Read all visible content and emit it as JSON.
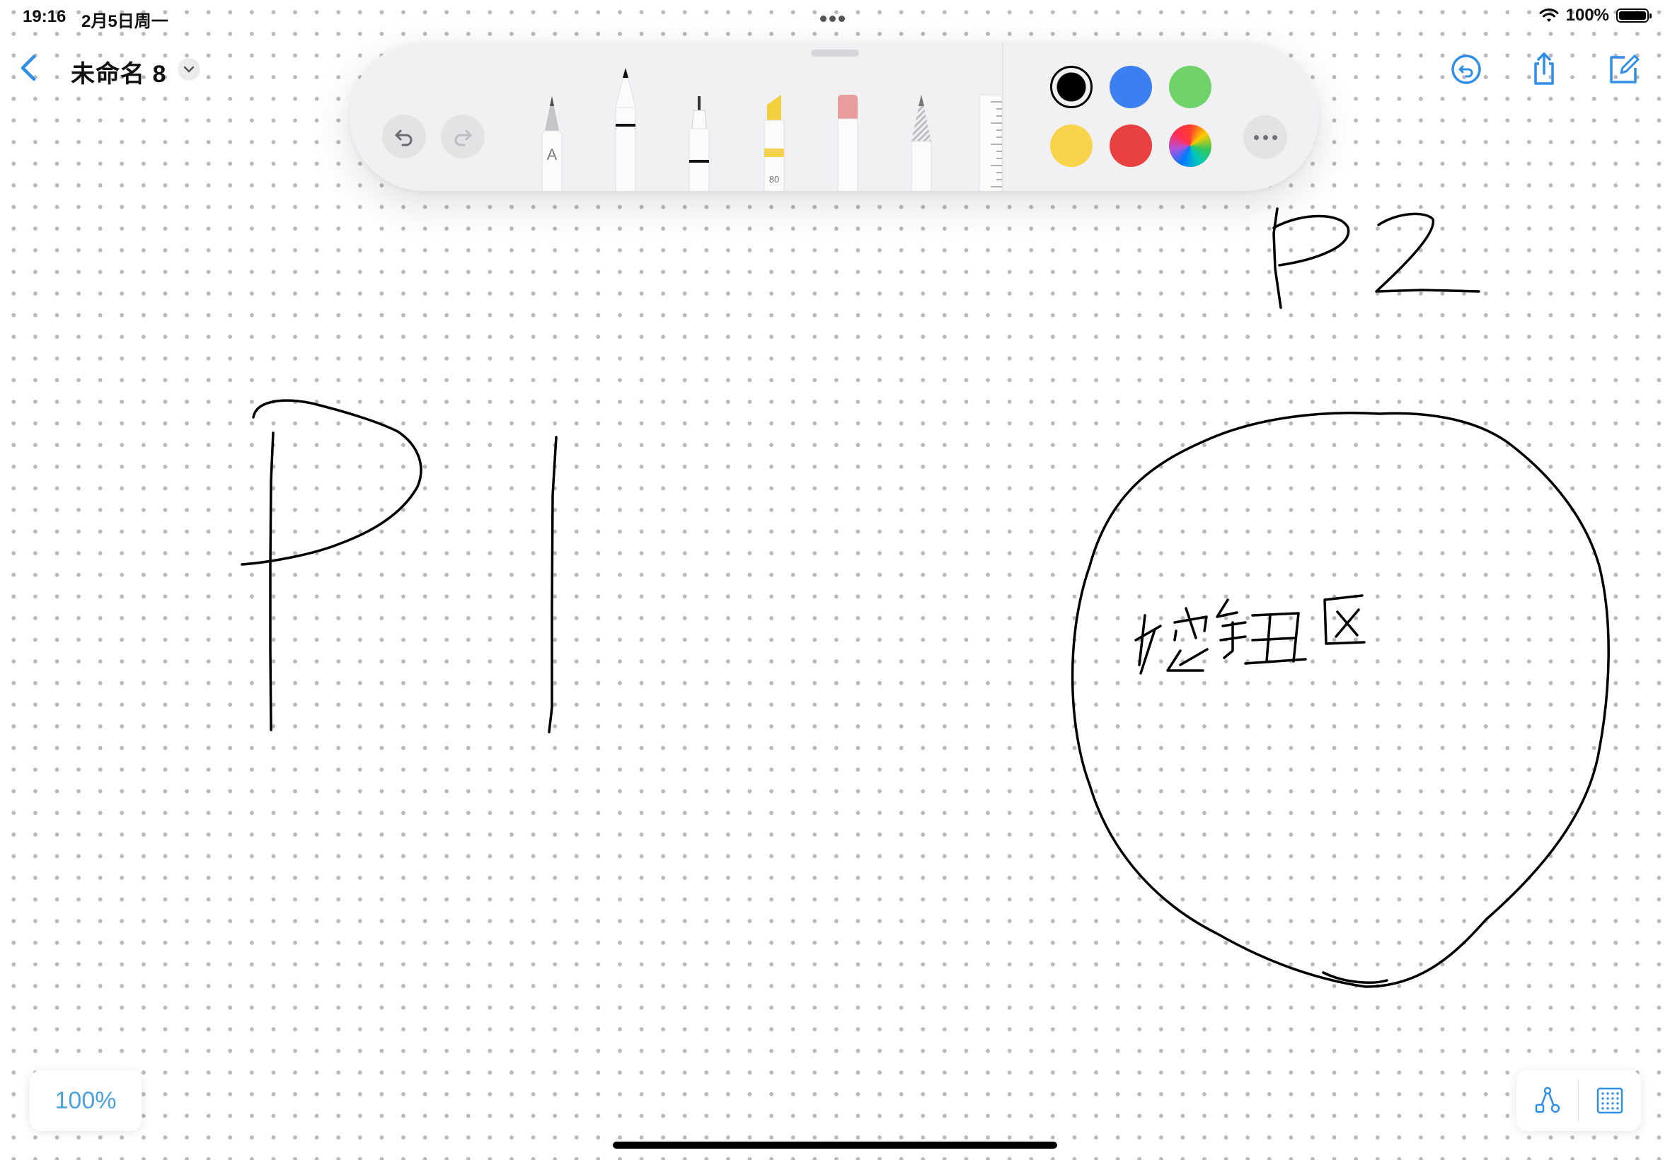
{
  "status_bar": {
    "time": "19:16",
    "date": "2月5日周一",
    "battery_percent": "100%",
    "battery_level": 1.0
  },
  "header": {
    "title": "未命名 8",
    "back_icon": "chevron-left-icon",
    "title_menu_icon": "chevron-down-icon",
    "right_icons": [
      "undo-history-icon",
      "share-icon",
      "compose-icon"
    ]
  },
  "toolbar": {
    "undo_icon": "undo-icon",
    "redo_icon": "redo-icon",
    "tools": [
      "monoline-pen",
      "pen",
      "fineliner",
      "marker",
      "eraser",
      "pencil",
      "ruler"
    ],
    "monoline_label": "A",
    "marker_opacity_label": "80",
    "colors": [
      "#000000",
      "#3b7ff0",
      "#6fd36a",
      "#f7d44c",
      "#e8413f",
      "color-wheel"
    ],
    "selected_color": "#000000",
    "more_icon": "ellipsis-icon"
  },
  "canvas": {
    "handwriting": [
      "P1",
      "P2",
      "按钮区"
    ]
  },
  "footer": {
    "zoom": "100%",
    "shapes_icon": "shapes-icon",
    "grid_icon": "grid-icon"
  }
}
